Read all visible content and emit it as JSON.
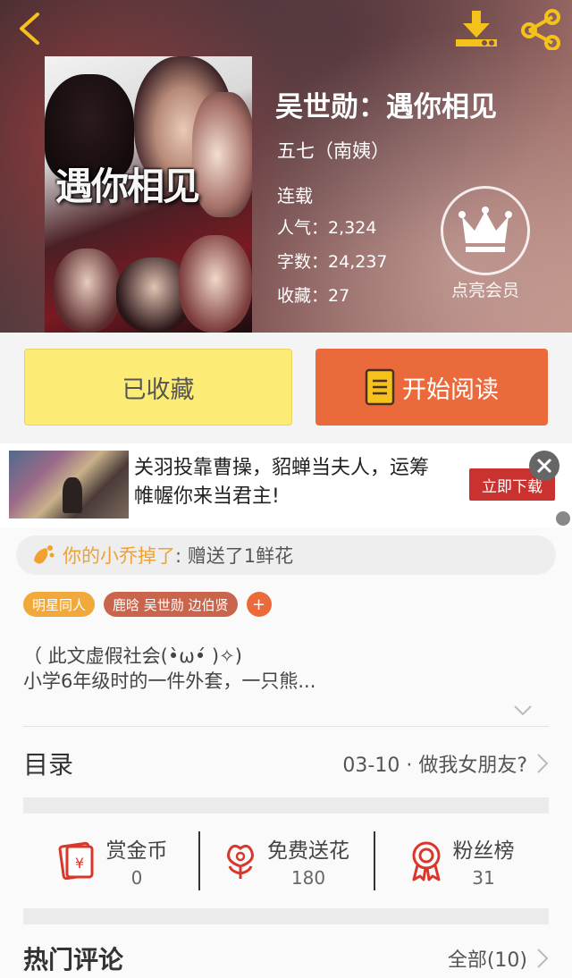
{
  "header": {
    "back_icon": "chevron-left-icon",
    "download_icon": "download-icon",
    "share_icon": "share-icon",
    "accent_color": "#f5c21c"
  },
  "book": {
    "cover_title": "遇你相见",
    "title": "吴世勋：遇你相见",
    "author": "五七（南姨）",
    "status": "连载",
    "stats": [
      {
        "label": "人气：",
        "value": "2,324"
      },
      {
        "label": "字数：",
        "value": "24,237"
      },
      {
        "label": "收藏：",
        "value": "27"
      }
    ]
  },
  "vip": {
    "icon": "crown-icon",
    "label": "点亮会员"
  },
  "actions": {
    "collected_label": "已收藏",
    "read_label": "开始阅读",
    "read_icon": "book-icon",
    "collected_color": "#fcec75",
    "read_color": "#eb6a3c"
  },
  "ad": {
    "text": "关羽投靠曹操，貂蝉当夫人，运筹帷幄你来当君主!",
    "download_label": "立即下载",
    "close_icon": "close-icon"
  },
  "gift": {
    "icon": "flower-icon",
    "name": "你的小乔掉了",
    "message": ": 赠送了1鲜花"
  },
  "tags": [
    "明星同人",
    "鹿晗 吴世勋 边伯贤"
  ],
  "tag_add_label": "+",
  "description": {
    "line1": "（ 此文虚假社会(•̀ω•́ )✧)",
    "line2": "小学6年级时的一件外套，一只熊..."
  },
  "toc": {
    "label": "目录",
    "latest": "03-10 · 做我女朋友?"
  },
  "stats_bar": [
    {
      "icon": "red-envelope-icon",
      "label": "赏金币",
      "value": "0"
    },
    {
      "icon": "flower-icon",
      "label": "免费送花",
      "value": "180"
    },
    {
      "icon": "ribbon-badge-icon",
      "label": "粉丝榜",
      "value": "31"
    }
  ],
  "comments": {
    "label": "热门评论",
    "all_label": "全部(10)"
  }
}
